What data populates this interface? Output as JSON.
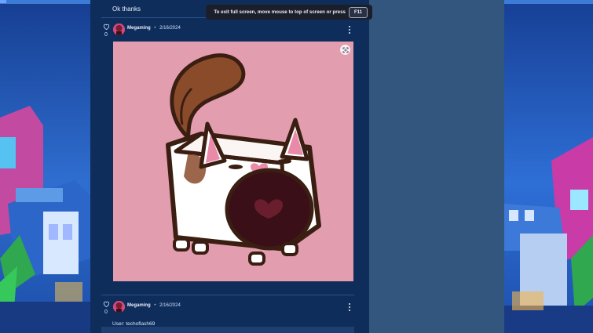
{
  "feed": {
    "previous_message": "Ok thanks",
    "posts": [
      {
        "like_icon": "heart-outline-icon",
        "likes": "0",
        "author": "Megaming",
        "separator": "•",
        "date": "2/16/2024",
        "image_description": "Pink image of a cute cube-shaped cat with a brown and white coat yelling with a wide open mouth."
      },
      {
        "like_icon": "heart-outline-icon",
        "likes": "0",
        "author": "Megaming",
        "separator": "•",
        "date": "2/16/2024",
        "text": "User: techoflash69"
      }
    ]
  },
  "overlay": {
    "message": "To exit full screen, move mouse to top of screen or press",
    "key": "F11"
  },
  "colors": {
    "feed_background": "#0f2d5b",
    "right_panel": "#32567e",
    "image_background": "#e29daf",
    "tooltip_background": "#1b1f2a"
  }
}
